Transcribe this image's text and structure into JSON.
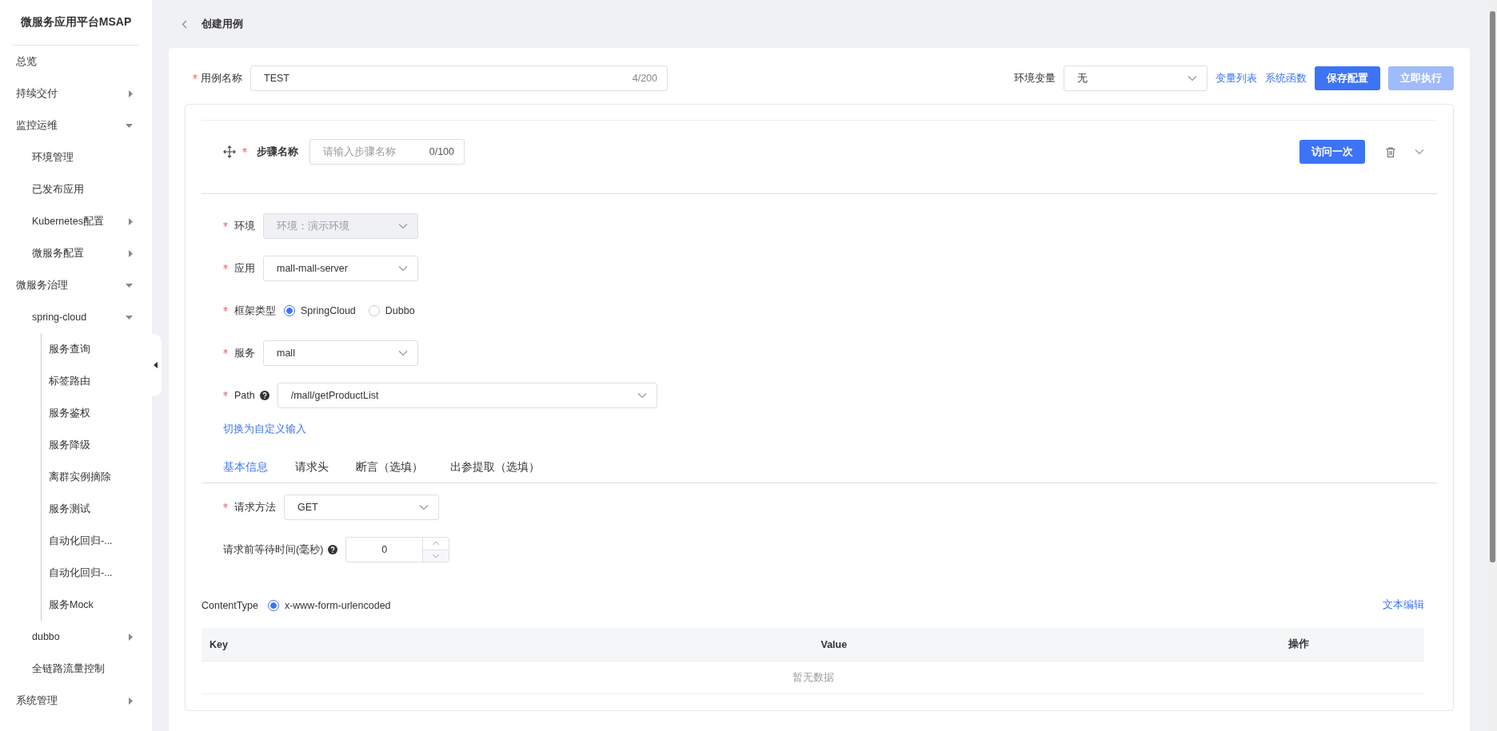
{
  "sidebar": {
    "title": "微服务应用平台MSAP",
    "items": [
      {
        "label": "总览"
      },
      {
        "label": "持续交付",
        "expanded": false
      },
      {
        "label": "监控运维",
        "expanded": true,
        "children": [
          {
            "label": "环境管理"
          },
          {
            "label": "已发布应用"
          },
          {
            "label": "Kubernetes配置",
            "expanded": false
          },
          {
            "label": "微服务配置",
            "expanded": false
          }
        ]
      },
      {
        "label": "微服务治理",
        "expanded": true,
        "children": [
          {
            "label": "spring-cloud",
            "expanded": true,
            "children": [
              {
                "label": "服务查询"
              },
              {
                "label": "标签路由"
              },
              {
                "label": "服务鉴权"
              },
              {
                "label": "服务降级"
              },
              {
                "label": "离群实例摘除"
              },
              {
                "label": "服务测试"
              },
              {
                "label": "自动化回归-..."
              },
              {
                "label": "自动化回归-..."
              },
              {
                "label": "服务Mock"
              }
            ]
          },
          {
            "label": "dubbo",
            "expanded": false
          },
          {
            "label": "全链路流量控制"
          }
        ]
      },
      {
        "label": "系统管理",
        "expanded": false
      }
    ]
  },
  "page": {
    "title": "创建用例"
  },
  "case_name": {
    "label": "用例名称",
    "required": true,
    "value": "TEST",
    "counter": "4/200"
  },
  "env_var": {
    "label": "环境变量",
    "value": "无"
  },
  "links": [
    "变量列表",
    "系统函数"
  ],
  "buttons": [
    {
      "label": "保存配置",
      "disabled": false
    },
    {
      "label": "立即执行",
      "disabled": true
    }
  ],
  "step": {
    "label": "步骤名称",
    "required": true,
    "placeholder": "请输入步骤名称",
    "counter": "0/100",
    "button": "访问一次"
  },
  "fields": [
    {
      "kind": "select",
      "label": "环境",
      "required": true,
      "value": "环境：演示环境",
      "disabled": true
    },
    {
      "kind": "select",
      "label": "应用",
      "required": true,
      "value": "mall-mall-server",
      "disabled": false
    },
    {
      "kind": "radio",
      "label": "框架类型",
      "required": true,
      "options": [
        {
          "label": "SpringCloud",
          "selected": true
        },
        {
          "label": "Dubbo",
          "selected": false
        }
      ]
    },
    {
      "kind": "select",
      "label": "服务",
      "required": true,
      "value": "mall",
      "disabled": false
    },
    {
      "kind": "path",
      "label": "Path",
      "required": true,
      "help": true,
      "value": "/mall/getProductList",
      "disabled": false
    }
  ],
  "switch_link": "切换为自定义输入",
  "tabs": [
    {
      "label": "基本信息",
      "selected": true
    },
    {
      "label": "请求头",
      "selected": false
    },
    {
      "label": "断言（选填）",
      "selected": false
    },
    {
      "label": "出参提取（选填）",
      "selected": false
    }
  ],
  "method": {
    "label": "请求方法",
    "required": true,
    "value": "GET"
  },
  "wait": {
    "label": "请求前等待时间(毫秒)",
    "help": true,
    "value": "0"
  },
  "content_type": {
    "label": "ContentType",
    "options": [
      {
        "label": "x-www-form-urlencoded",
        "selected": true
      }
    ]
  },
  "text_edit_link": "文本编辑",
  "table": {
    "columns": [
      "Key",
      "Value",
      "操作"
    ],
    "empty": "暂无数据"
  }
}
